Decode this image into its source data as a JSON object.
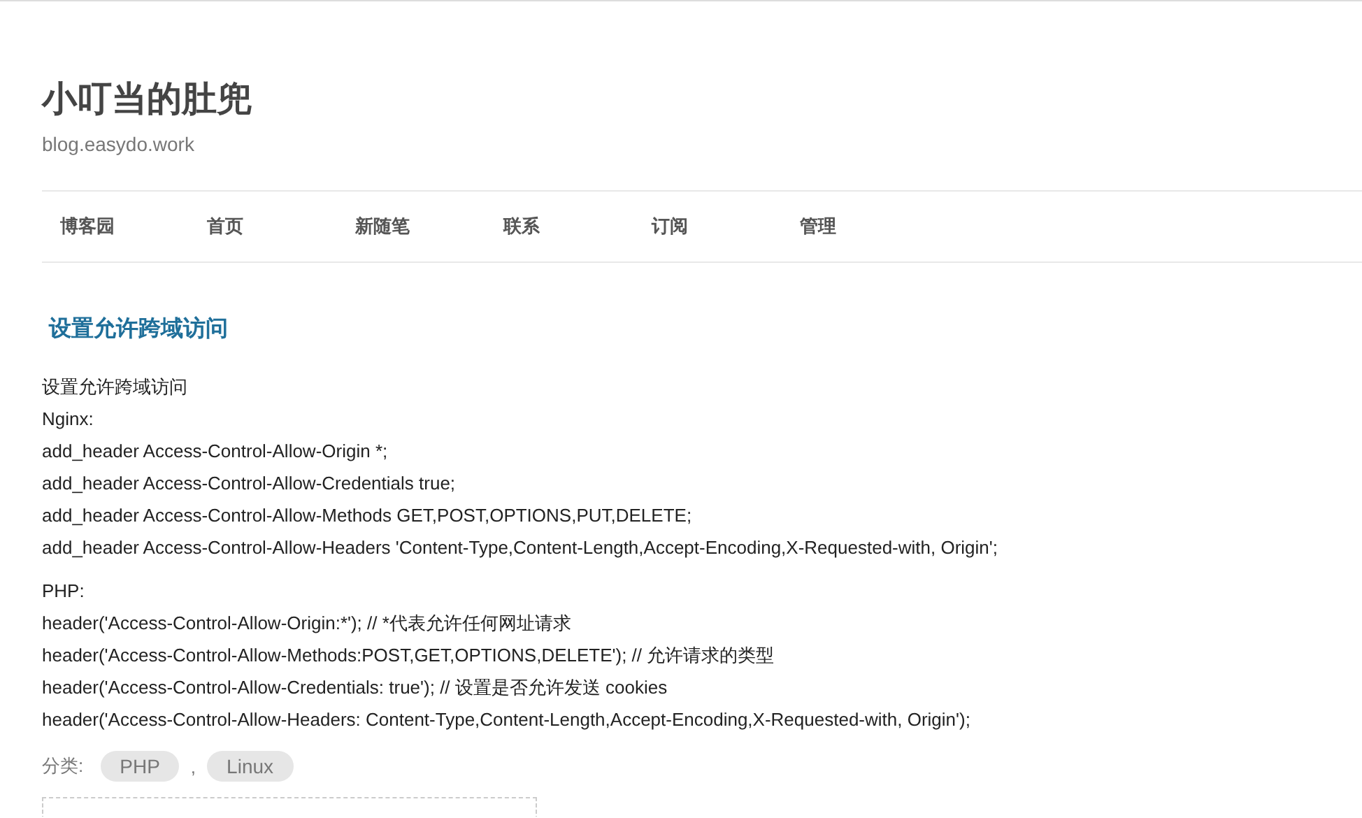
{
  "blog": {
    "title": "小叮当的肚兜",
    "subtitle": "blog.easydo.work"
  },
  "nav": [
    "博客园",
    "首页",
    "新随笔",
    "联系",
    "订阅",
    "管理"
  ],
  "post": {
    "title": "设置允许跨域访问",
    "paragraphs": [
      [
        "设置允许跨域访问",
        "Nginx:",
        "add_header Access-Control-Allow-Origin *;",
        "add_header Access-Control-Allow-Credentials true;",
        "add_header Access-Control-Allow-Methods GET,POST,OPTIONS,PUT,DELETE;",
        "add_header Access-Control-Allow-Headers 'Content-Type,Content-Length,Accept-Encoding,X-Requested-with, Origin';"
      ],
      [
        "PHP:",
        "header('Access-Control-Allow-Origin:*'); // *代表允许任何网址请求",
        "header('Access-Control-Allow-Methods:POST,GET,OPTIONS,DELETE'); // 允许请求的类型",
        "header('Access-Control-Allow-Credentials: true'); // 设置是否允许发送 cookies",
        "header('Access-Control-Allow-Headers: Content-Type,Content-Length,Accept-Encoding,X-Requested-with, Origin');"
      ]
    ],
    "category_label": "分类:",
    "categories": [
      "PHP",
      "Linux"
    ],
    "category_separator": ","
  }
}
